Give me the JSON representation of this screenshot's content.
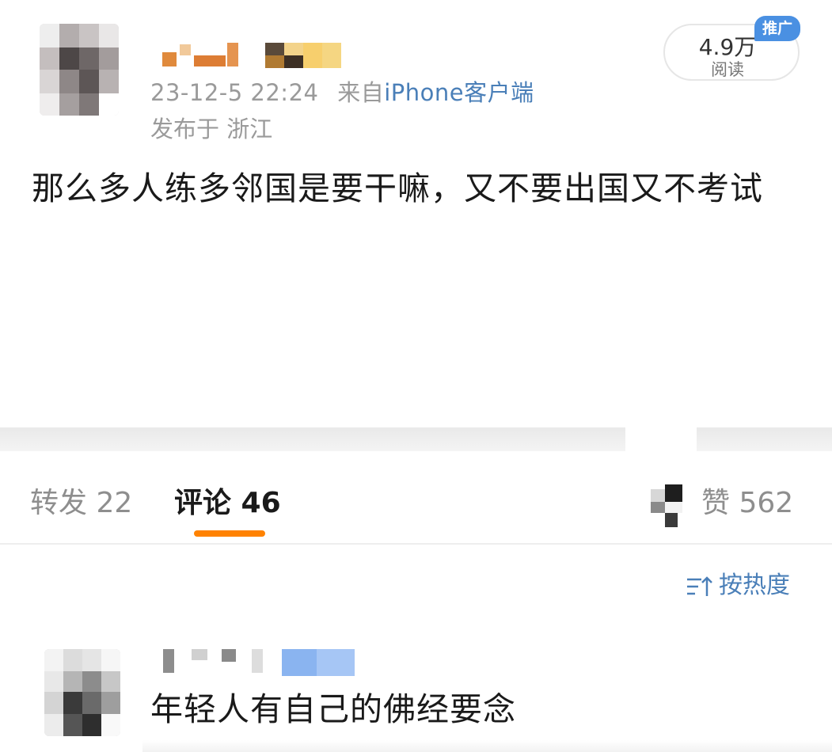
{
  "post": {
    "timestamp": "23-12-5 22:24",
    "source_prefix": "来自",
    "source": "iPhone客户端",
    "location": "发布于 浙江",
    "read_count": "4.9万",
    "read_label": "阅读",
    "promo_badge": "推广",
    "content": "那么多人练多邻国是要干嘛，又不要出国又不考试"
  },
  "tabs": {
    "repost": "转发 22",
    "comments": "评论 46",
    "likes": "赞 562"
  },
  "sort": {
    "label": "按热度"
  },
  "comment": {
    "text": "年轻人有自己的佛经要念"
  },
  "colors": {
    "accent": "#ff8200",
    "link": "#4a7fb8",
    "badge": "#4a90e2"
  }
}
